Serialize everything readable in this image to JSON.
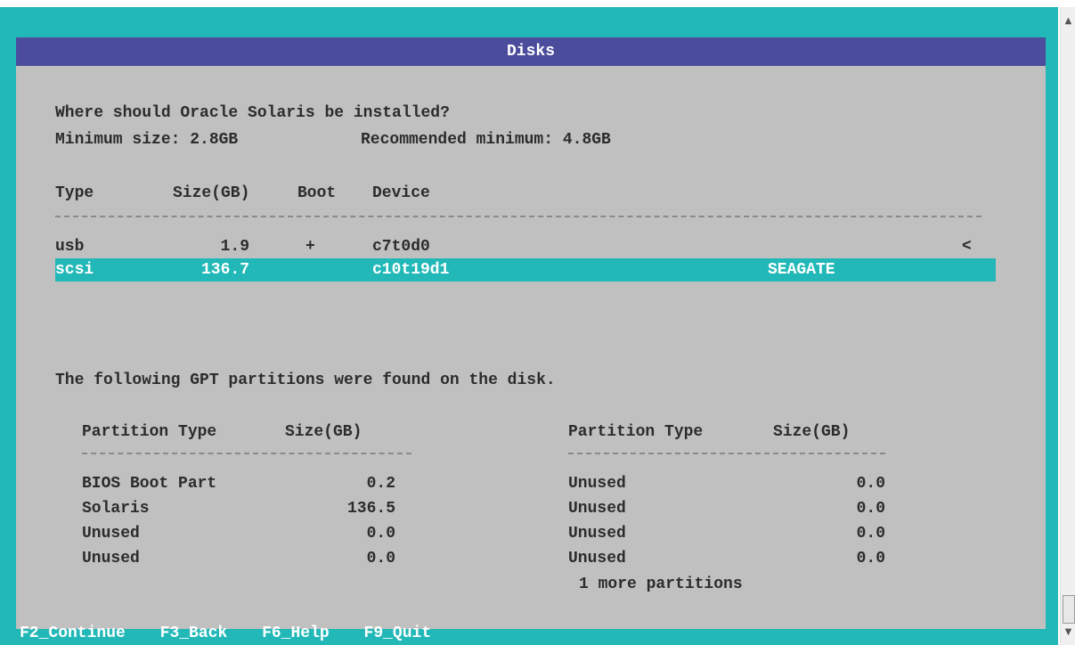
{
  "window": {
    "title": "Disks"
  },
  "prompt": {
    "question": "Where should Oracle Solaris be installed?",
    "min_size": "Minimum size: 2.8GB",
    "rec_min": "Recommended minimum: 4.8GB"
  },
  "disk_table": {
    "headers": {
      "type": "Type",
      "size": "Size(GB)",
      "boot": "Boot",
      "device": "Device"
    },
    "rows": [
      {
        "type": "usb",
        "size": "1.9",
        "boot": "+",
        "device": "c7t0d0",
        "vendor": "",
        "marker": "<",
        "selected": false
      },
      {
        "type": "scsi",
        "size": "136.7",
        "boot": "",
        "device": "c10t19d1",
        "vendor": "SEAGATE",
        "marker": "",
        "selected": true
      }
    ]
  },
  "partitions": {
    "message": "The following GPT partitions were found on the disk.",
    "header_type": "Partition Type",
    "header_size": "Size(GB)",
    "left": [
      {
        "type": "BIOS Boot Part",
        "size": "0.2"
      },
      {
        "type": "Solaris",
        "size": "136.5"
      },
      {
        "type": "Unused",
        "size": "0.0"
      },
      {
        "type": "Unused",
        "size": "0.0"
      }
    ],
    "right": [
      {
        "type": "Unused",
        "size": "0.0"
      },
      {
        "type": "Unused",
        "size": "0.0"
      },
      {
        "type": "Unused",
        "size": "0.0"
      },
      {
        "type": "Unused",
        "size": "0.0"
      }
    ],
    "more": "1 more partitions"
  },
  "function_keys": [
    {
      "label": "F2_Continue"
    },
    {
      "label": "F3_Back"
    },
    {
      "label": "F6_Help"
    },
    {
      "label": "F9_Quit"
    }
  ],
  "colors": {
    "background": "#22b8b8",
    "panel": "#c0c0c0",
    "titlebar": "#4b4d9c",
    "selected_row": "#22b8b8"
  },
  "icons": [
    "scroll-up-icon",
    "scroll-down-icon",
    "scroll-grip-icon"
  ]
}
